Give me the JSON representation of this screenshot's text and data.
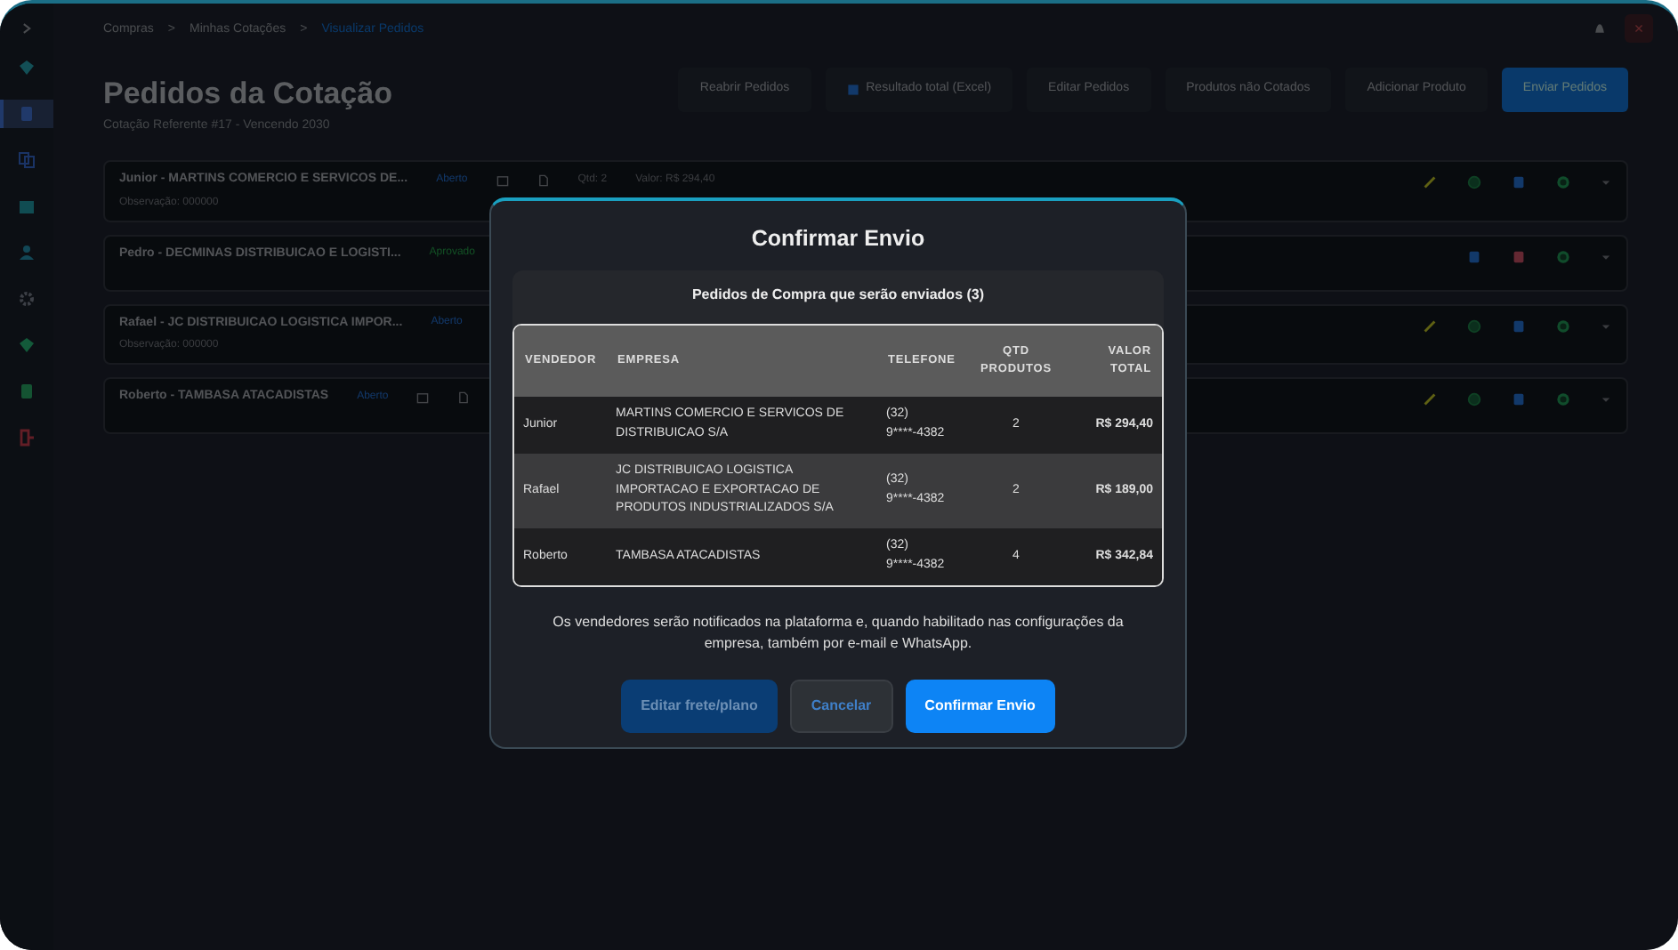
{
  "sidebar": {
    "items": [
      {
        "kind": "diamond",
        "selected": false
      },
      {
        "kind": "doc",
        "selected": true
      },
      {
        "kind": "copy",
        "selected": false
      },
      {
        "kind": "box",
        "selected": false
      },
      {
        "kind": "user",
        "selected": false
      },
      {
        "kind": "gear",
        "selected": false
      },
      {
        "kind": "gem",
        "selected": false
      },
      {
        "kind": "sheet",
        "selected": false
      },
      {
        "kind": "exit",
        "selected": false
      }
    ]
  },
  "breadcrumb": [
    {
      "kind": "link",
      "label": "Compras"
    },
    {
      "kind": "separator",
      "label": ">"
    },
    {
      "kind": "link",
      "label": "Minhas Cotações"
    },
    {
      "kind": "separator",
      "label": ">"
    },
    {
      "kind": "current",
      "label": "Visualizar Pedidos"
    }
  ],
  "close_button": "×",
  "page": {
    "title": "Pedidos da Cotação",
    "subtitle": "Cotação Referente #17 - Vencendo 2030",
    "buttons": [
      {
        "label": "Reabrir Pedidos",
        "primary": false,
        "icon": false
      },
      {
        "label": "Resultado total (Excel)",
        "primary": false,
        "icon": true
      },
      {
        "label": "Editar Pedidos",
        "primary": false,
        "icon": false
      },
      {
        "label": "Produtos não Cotados",
        "primary": false,
        "icon": false
      },
      {
        "label": "Adicionar Produto",
        "primary": false,
        "icon": false
      },
      {
        "label": "Enviar Pedidos",
        "primary": true,
        "icon": false
      }
    ]
  },
  "orders": [
    {
      "title": "Junior - MARTINS COMERCIO E SERVICOS DE...",
      "status": "Aberto",
      "approved": false,
      "meta_icons": [
        {
          "kind": "calendar"
        },
        {
          "kind": "file"
        }
      ],
      "qty": "Qtd: 2",
      "value": "Valor: R$ 294,40",
      "note": "Observação: 000000",
      "actions": [
        {
          "kind": "edit"
        },
        {
          "kind": "check"
        },
        {
          "kind": "doc"
        },
        {
          "kind": "whatsapp"
        }
      ]
    },
    {
      "title": "Pedro - DECMINAS DISTRIBUICAO E LOGISTI...",
      "status": "Aprovado",
      "approved": true,
      "actions": [
        {
          "kind": "doc"
        },
        {
          "kind": "delete"
        },
        {
          "kind": "whatsapp"
        }
      ]
    },
    {
      "title": "Rafael - JC DISTRIBUICAO LOGISTICA IMPOR...",
      "status": "Aberto",
      "approved": false,
      "note": "Observação: 000000",
      "actions": [
        {
          "kind": "edit"
        },
        {
          "kind": "check"
        },
        {
          "kind": "doc"
        },
        {
          "kind": "whatsapp"
        }
      ]
    },
    {
      "title": "Roberto - TAMBASA ATACADISTAS",
      "status": "Aberto",
      "approved": false,
      "meta_icons": [
        {
          "kind": "calendar"
        },
        {
          "kind": "file"
        }
      ],
      "actions": [
        {
          "kind": "edit"
        },
        {
          "kind": "check"
        },
        {
          "kind": "doc"
        },
        {
          "kind": "whatsapp"
        }
      ]
    }
  ],
  "modal": {
    "title": "Confirmar Envio",
    "subtitle": "Pedidos de Compra que serão enviados (3)",
    "columns": [
      "VENDEDOR",
      "EMPRESA",
      "TELEFONE",
      "QTD PRODUTOS",
      "VALOR TOTAL"
    ],
    "rows": [
      {
        "vendedor": "Junior",
        "empresa": "MARTINS COMERCIO E SERVICOS DE DISTRIBUICAO S/A",
        "telefone": [
          "(32)",
          "9****-4382"
        ],
        "qtd": "2",
        "total": "R$ 294,40",
        "hovered": false
      },
      {
        "vendedor": "Rafael",
        "empresa": "JC DISTRIBUICAO LOGISTICA IMPORTACAO E EXPORTACAO DE PRODUTOS INDUSTRIALIZADOS S/A",
        "telefone": [
          "(32)",
          "9****-4382"
        ],
        "qtd": "2",
        "total": "R$ 189,00",
        "hovered": true
      },
      {
        "vendedor": "Roberto",
        "empresa": "TAMBASA ATACADISTAS",
        "telefone": [
          "(32)",
          "9****-4382"
        ],
        "qtd": "4",
        "total": "R$ 342,84",
        "hovered": false
      }
    ],
    "note": "Os vendedores serão notificados na plataforma e, quando habilitado nas configurações da empresa, também por e-mail e WhatsApp.",
    "buttons": [
      {
        "label": "Editar frete/plano",
        "kind": "secondary"
      },
      {
        "label": "Cancelar",
        "kind": "cancel"
      },
      {
        "label": "Confirmar Envio",
        "kind": "primary"
      }
    ]
  }
}
